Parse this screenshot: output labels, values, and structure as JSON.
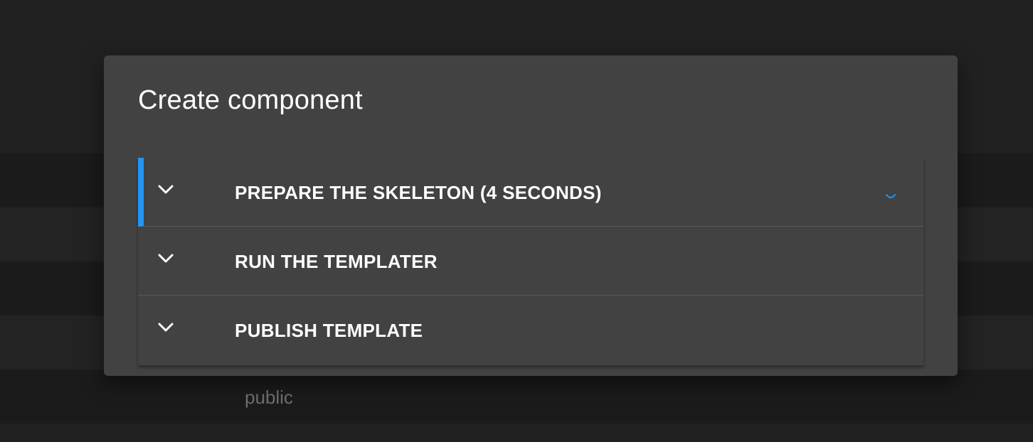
{
  "background": {
    "visible_text": "public"
  },
  "dialog": {
    "title": "Create component",
    "steps": [
      {
        "label": "PREPARE THE SKELETON (4 SECONDS)",
        "state": "in-progress",
        "icon": "chevron-down-icon"
      },
      {
        "label": "RUN THE TEMPLATER",
        "state": "pending",
        "icon": "chevron-down-icon"
      },
      {
        "label": "PUBLISH TEMPLATE",
        "state": "pending",
        "icon": "chevron-down-icon"
      }
    ]
  },
  "colors": {
    "accent": "#2196f3",
    "dialog_bg": "#424242",
    "page_bg": "#212121"
  }
}
